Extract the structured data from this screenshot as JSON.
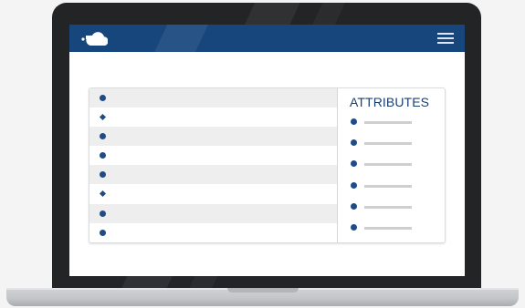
{
  "header": {
    "logo_icon": "cloud-logo-icon",
    "menu_icon": "hamburger-menu-icon",
    "background_color": "#17467d"
  },
  "list": {
    "items": [
      {
        "bullet": "circle",
        "shaded": true
      },
      {
        "bullet": "diamond",
        "shaded": false
      },
      {
        "bullet": "circle",
        "shaded": true
      },
      {
        "bullet": "circle",
        "shaded": false
      },
      {
        "bullet": "circle",
        "shaded": true
      },
      {
        "bullet": "diamond",
        "shaded": false
      },
      {
        "bullet": "circle",
        "shaded": true
      },
      {
        "bullet": "circle",
        "shaded": false
      }
    ]
  },
  "attributes": {
    "title": "ATTRIBUTES",
    "item_count": 6
  },
  "colors": {
    "accent": "#1f4c86",
    "placeholder_line": "#cfcfcf"
  }
}
